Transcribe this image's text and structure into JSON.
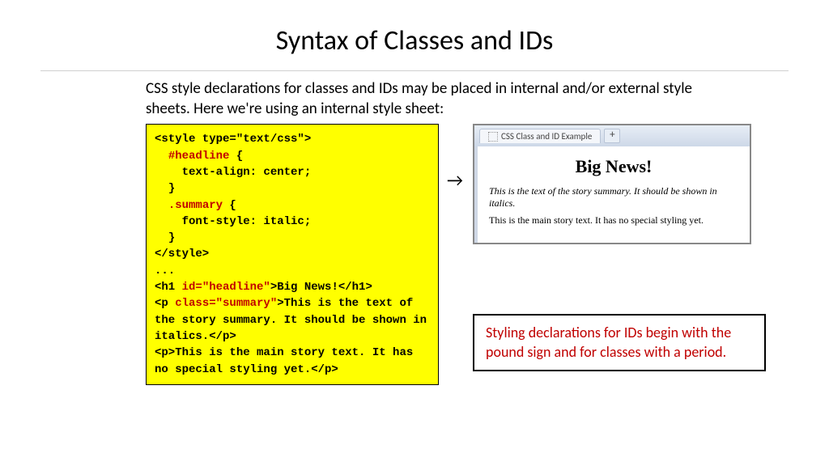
{
  "title": "Syntax of Classes and IDs",
  "intro": "CSS style declarations for classes and IDs may be placed in internal and/or external style sheets.  Here we're using an internal style sheet:",
  "code": {
    "l1a": "<style type=\"text/css\">",
    "l2r": "#headline",
    "l2b": " {",
    "l3": "text-align: center;",
    "l4": "}",
    "l5r": ".summary",
    "l5b": " {",
    "l6": "font-style: italic;",
    "l7": "}",
    "l8": "</style>",
    "l9": "...",
    "l10a": "<h1 ",
    "l10r": "id=\"headline\"",
    "l10b": ">Big News!</h1>",
    "l11a": "<p ",
    "l11r": "class=\"summary\"",
    "l11b": ">This is the text of the story summary. It should be shown in italics.</p>",
    "l12": "<p>This is the main story text. It has no special styling yet.</p>"
  },
  "browser": {
    "tab": "CSS Class and ID Example",
    "h": "Big News!",
    "p1": "This is the text of the story summary. It should be shown in italics.",
    "p2": "This is the main story text. It has no special styling yet."
  },
  "note": "Styling declarations for IDs begin with the pound sign and for classes with a period."
}
